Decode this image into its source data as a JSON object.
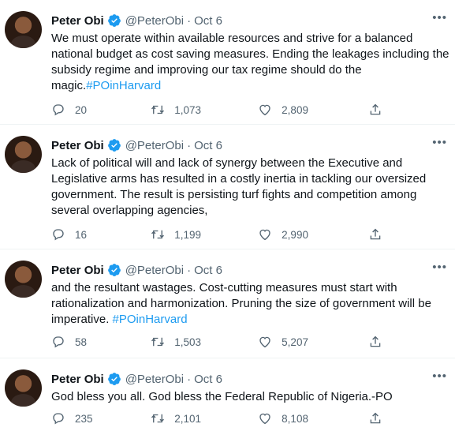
{
  "tweets": [
    {
      "name": "Peter Obi",
      "handle": "@PeterObi",
      "date": "Oct 6",
      "text": "We must operate within available resources and strive for a balanced national budget as cost saving measures. Ending the leakages including the subsidy regime and improving our tax regime should do the magic.",
      "hashtag": "#POinHarvard",
      "replies": "20",
      "retweets": "1,073",
      "likes": "2,809"
    },
    {
      "name": "Peter Obi",
      "handle": "@PeterObi",
      "date": "Oct 6",
      "text": "Lack of political will and lack of synergy between the Executive and Legislative arms has resulted in a costly inertia in tackling our oversized government.  The result is persisting turf fights and competition among several overlapping agencies,",
      "hashtag": "",
      "replies": "16",
      "retweets": "1,199",
      "likes": "2,990"
    },
    {
      "name": "Peter Obi",
      "handle": "@PeterObi",
      "date": "Oct 6",
      "text": "and the resultant wastages.  Cost-cutting measures must start with rationalization and harmonization. Pruning the size of government will be imperative. ",
      "hashtag": "#POinHarvard",
      "replies": "58",
      "retweets": "1,503",
      "likes": "5,207"
    },
    {
      "name": "Peter Obi",
      "handle": "@PeterObi",
      "date": "Oct 6",
      "text": "God bless you all. God bless the Federal Republic of Nigeria.-PO",
      "hashtag": "",
      "replies": "235",
      "retweets": "2,101",
      "likes": "8,108"
    }
  ],
  "icons": {
    "verified": "verified-badge-icon",
    "more": "more-options-icon",
    "reply": "reply-icon",
    "retweet": "retweet-icon",
    "like": "heart-icon",
    "share": "share-icon"
  },
  "colors": {
    "accent": "#1d9bf0",
    "text": "#0f1419",
    "secondary": "#536471"
  },
  "more_glyph": "•••",
  "dot": "·"
}
